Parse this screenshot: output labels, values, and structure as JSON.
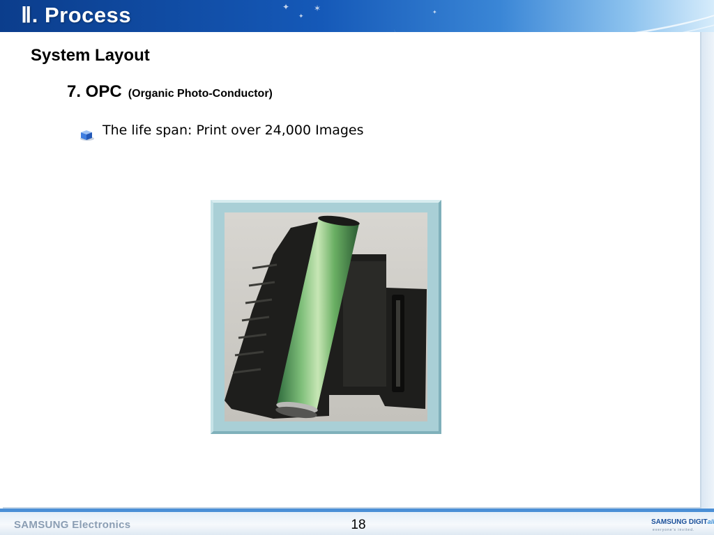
{
  "header": {
    "title": "Ⅱ.  Process"
  },
  "content": {
    "section_title": "System Layout",
    "sub_heading": {
      "main": "7. OPC",
      "parenthetical": "(Organic Photo-Conductor)"
    },
    "bullets": [
      {
        "icon": "cube-bullet-icon",
        "text": "The life span: Print over 24,000 Images"
      }
    ],
    "image": {
      "subject": "opc-drum-unit-photo"
    }
  },
  "footer": {
    "brand": "SAMSUNG Electronics",
    "page_number": "18",
    "logo_main": "SAMSUNG DIGIT",
    "logo_suffix": "all",
    "logo_sub": "everyone's invited."
  },
  "colors": {
    "header_blue": "#1559b8",
    "footer_accent": "#4a8fd6",
    "frame_teal": "#a9cfd6"
  }
}
